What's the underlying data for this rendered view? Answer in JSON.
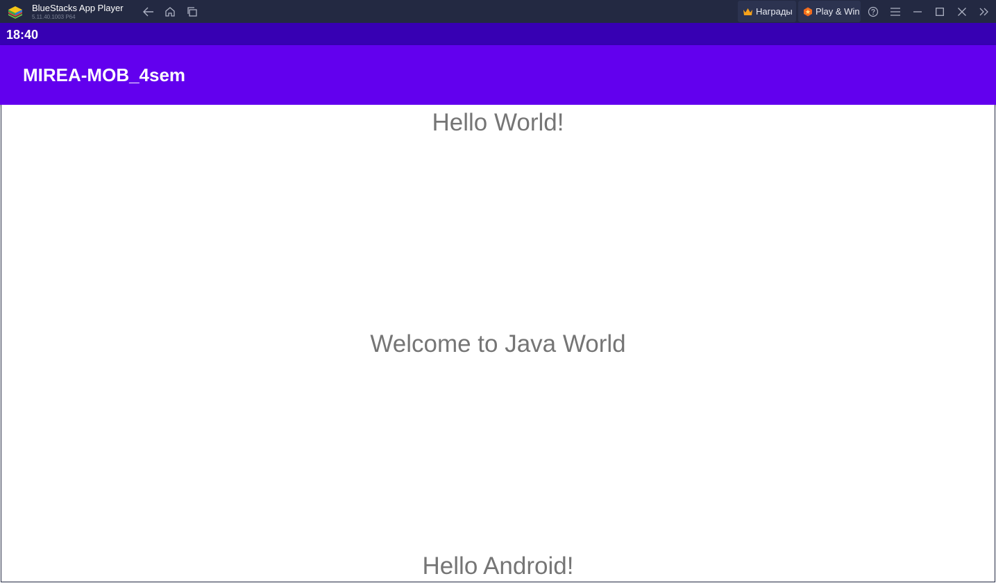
{
  "window": {
    "app_title": "BlueStacks App Player",
    "app_version": "5.11.40.1003 P64",
    "nav": {
      "back_icon": "back-arrow-icon",
      "home_icon": "home-icon",
      "recents_icon": "recent-apps-icon"
    },
    "rewards_label": "Награды",
    "play_win_label": "Play & Win",
    "controls": [
      "help-icon",
      "menu-icon",
      "minimize-icon",
      "maximize-icon",
      "close-icon",
      "sidebar-toggle-icon"
    ]
  },
  "status_bar": {
    "time": "18:40"
  },
  "app_bar": {
    "title": "MIREA-MOB_4sem"
  },
  "content": {
    "top_text": "Hello World!",
    "middle_text": "Welcome to Java World",
    "bottom_text": "Hello Android!"
  },
  "colors": {
    "titlebar": "#232942",
    "status_bar": "#3700b3",
    "app_bar": "#6200ee",
    "body_text": "#757575"
  }
}
